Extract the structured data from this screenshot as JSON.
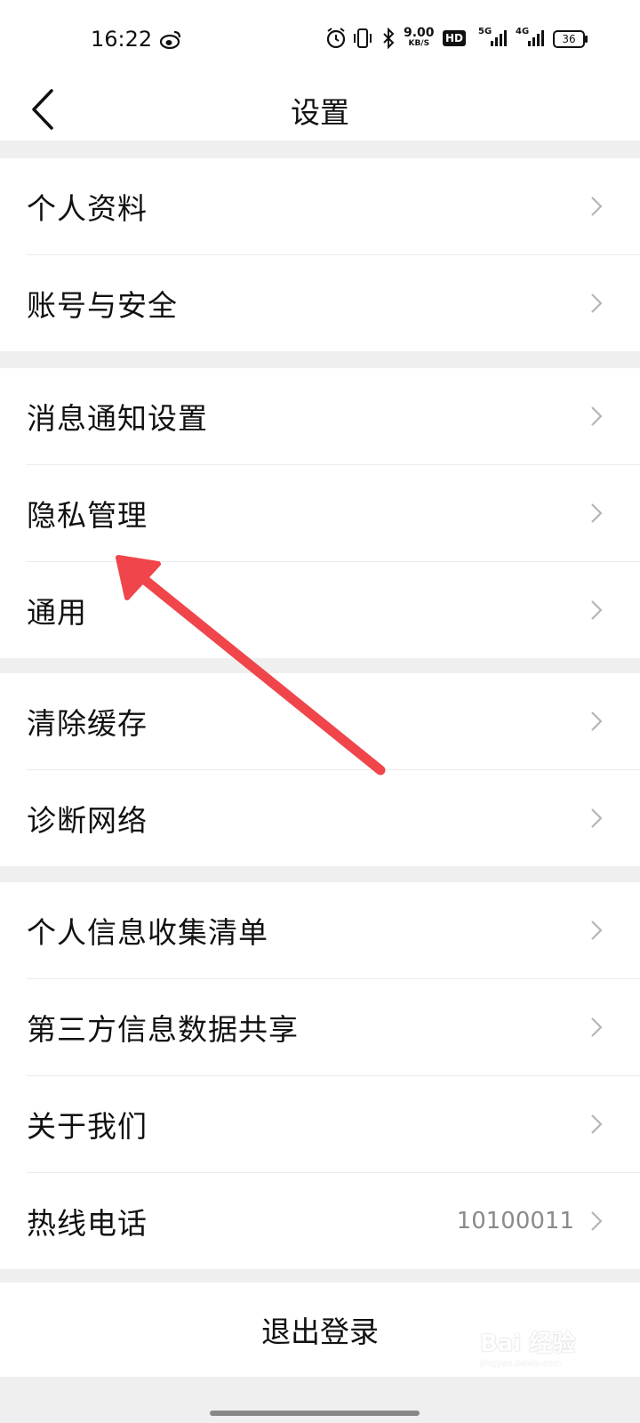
{
  "status_bar": {
    "time": "16:22",
    "net_speed_value": "9.00",
    "net_speed_unit": "KB/S",
    "hd_label": "HD",
    "sim1_label": "5G",
    "sim2_label": "4G",
    "battery": "36",
    "icons": [
      "weibo-icon",
      "alarm-icon",
      "vibrate-icon",
      "bluetooth-icon",
      "hd-icon",
      "signal-5g-icon",
      "signal-4g-icon",
      "battery-icon"
    ]
  },
  "nav": {
    "title": "设置",
    "back_icon": "chevron-left-icon"
  },
  "groups": [
    {
      "items": [
        {
          "label": "个人资料"
        },
        {
          "label": "账号与安全"
        }
      ]
    },
    {
      "items": [
        {
          "label": "消息通知设置"
        },
        {
          "label": "隐私管理"
        },
        {
          "label": "通用"
        }
      ]
    },
    {
      "items": [
        {
          "label": "清除缓存"
        },
        {
          "label": "诊断网络"
        }
      ]
    },
    {
      "items": [
        {
          "label": "个人信息收集清单"
        },
        {
          "label": "第三方信息数据共享"
        },
        {
          "label": "关于我们"
        },
        {
          "label": "热线电话",
          "value": "10100011"
        }
      ]
    }
  ],
  "logout_label": "退出登录",
  "watermark": {
    "text": "Bai 经验",
    "sub": "jingyan.baidu.com"
  },
  "colors": {
    "annotation_arrow": "#f0454a",
    "chevron": "#b5b5b5",
    "page_bg": "#efefef"
  }
}
